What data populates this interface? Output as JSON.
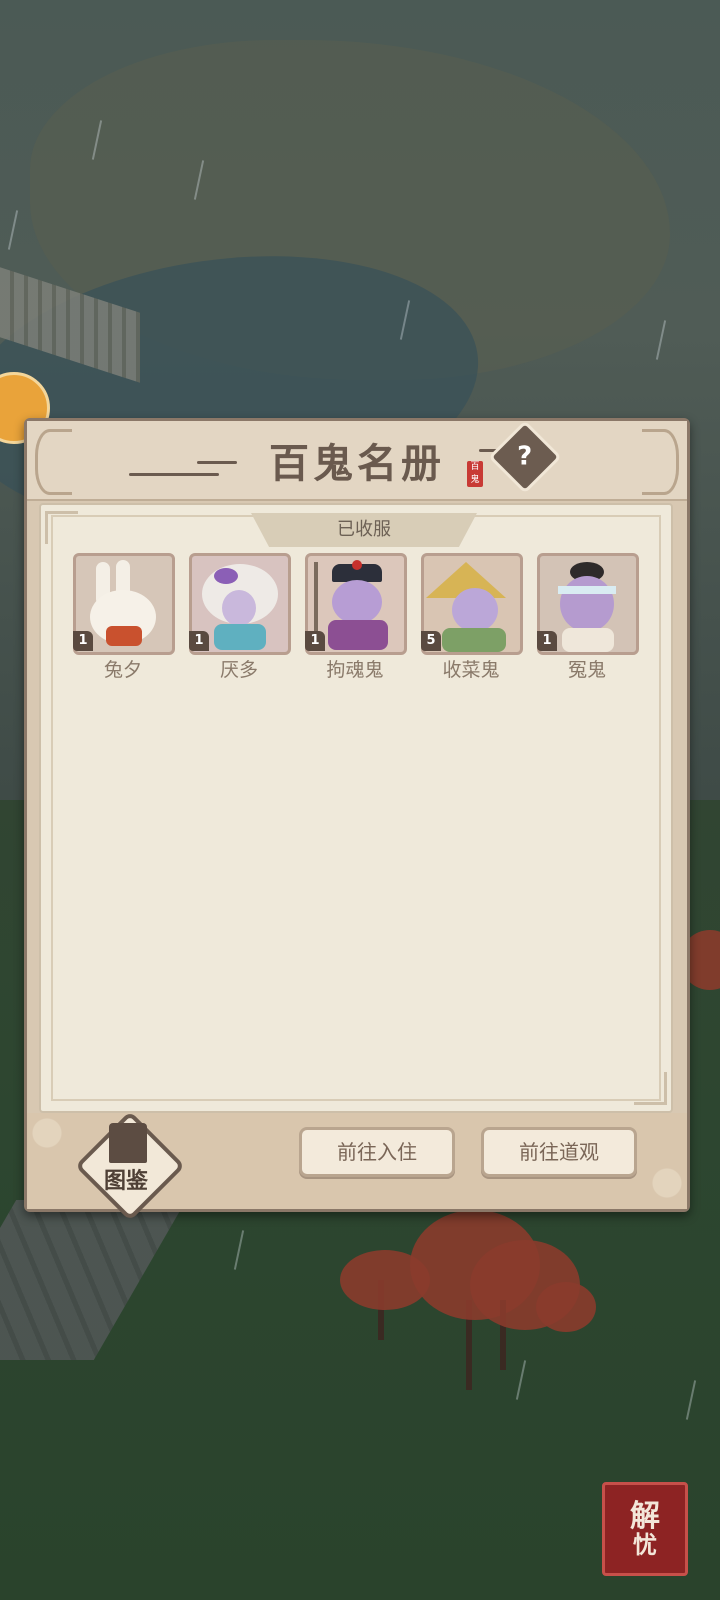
{
  "panel": {
    "title": "百鬼名册",
    "title_stamp": "百鬼",
    "help_symbol": "?",
    "section_label": "已收服",
    "ghosts": [
      {
        "name": "兔夕",
        "level": "1",
        "icon": "rabbit-portrait"
      },
      {
        "name": "厌多",
        "level": "1",
        "icon": "white-haired-ghost-portrait"
      },
      {
        "name": "拘魂鬼",
        "level": "1",
        "icon": "soul-catcher-portrait"
      },
      {
        "name": "收菜鬼",
        "level": "5",
        "icon": "straw-hat-ghost-portrait"
      },
      {
        "name": "冤鬼",
        "level": "1",
        "icon": "headband-ghost-portrait"
      }
    ],
    "footer": {
      "codex_label": "图鉴",
      "enter_label": "前往入住",
      "temple_label": "前往道观"
    }
  },
  "hud": {
    "seal_text_1": "解",
    "seal_text_2": "忧"
  },
  "colors": {
    "panel_bg": "#d8c8b2",
    "inner_bg": "#efe9da",
    "title_color": "#6a5a4e",
    "seal_red": "#8d2323"
  }
}
